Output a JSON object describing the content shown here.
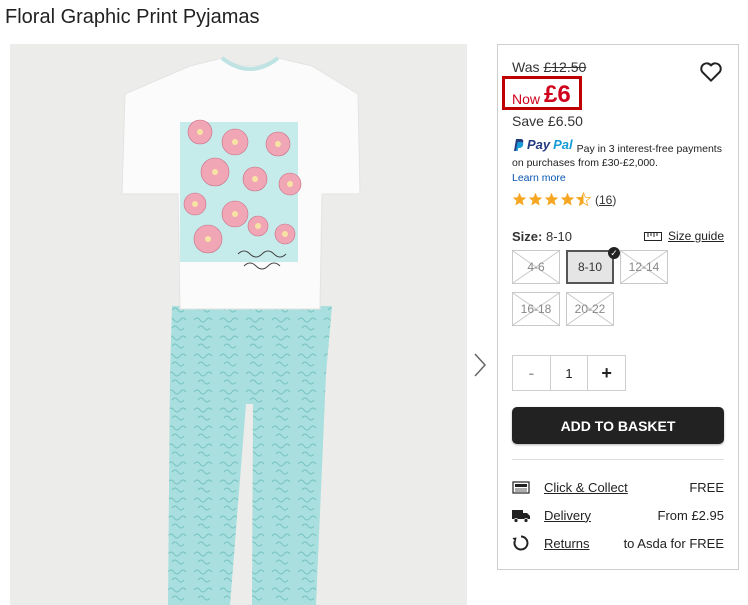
{
  "product": {
    "title": "Floral Graphic Print Pyjamas"
  },
  "pricing": {
    "was_label": "Was",
    "was_amount": "£12.50",
    "now_label": "Now",
    "now_amount": "£6",
    "save_label": "Save",
    "save_amount": "£6.50",
    "accent_color": "#d0021b"
  },
  "paypal": {
    "logo_pay": "Pay",
    "logo_pal": "Pal",
    "message": "Pay in 3 interest-free payments on purchases from £30-£2,000.",
    "learn_more": "Learn more"
  },
  "rating": {
    "stars": 4.5,
    "count": "16"
  },
  "size": {
    "label": "Size:",
    "selected": "8-10",
    "guide_label": "Size guide",
    "options": [
      {
        "label": "4-6",
        "available": false
      },
      {
        "label": "8-10",
        "available": true,
        "selected": true
      },
      {
        "label": "12-14",
        "available": false
      },
      {
        "label": "16-18",
        "available": false
      },
      {
        "label": "20-22",
        "available": false
      }
    ]
  },
  "quantity": {
    "minus": "-",
    "value": "1",
    "plus": "+"
  },
  "basket": {
    "label": "ADD TO BASKET"
  },
  "delivery": [
    {
      "icon": "click-collect-icon",
      "label": "Click & Collect",
      "price": "FREE"
    },
    {
      "icon": "delivery-truck-icon",
      "label": "Delivery",
      "price": "From £2.95"
    },
    {
      "icon": "returns-icon",
      "label": "Returns",
      "price": "to Asda for FREE"
    }
  ],
  "icons": {
    "wishlist": "heart-icon",
    "next": "chevron-right-icon",
    "size_guide": "ruler-icon"
  }
}
